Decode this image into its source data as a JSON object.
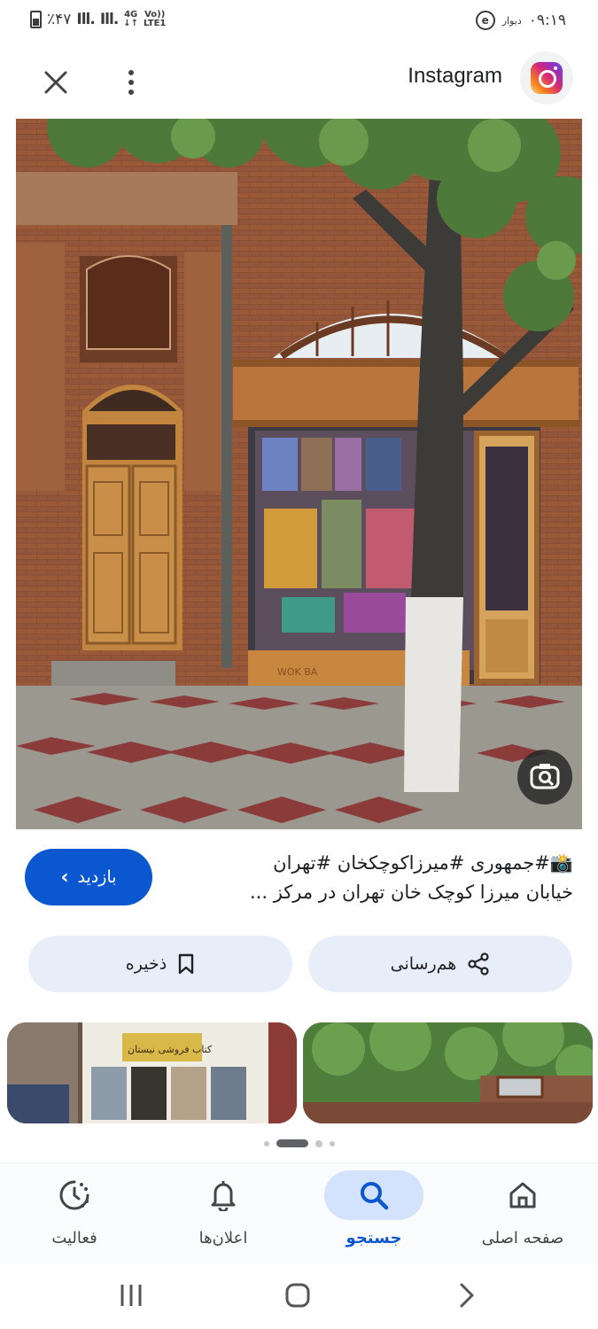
{
  "status_bar": {
    "battery": "٪۴۷",
    "network_type": "4G",
    "volte": "Vo))",
    "lte": "LTE1",
    "time": "۰۹:۱۹",
    "notification_app_label": "دیوار",
    "notification_app_glyph": "e"
  },
  "header": {
    "source_name": "Instagram",
    "close_icon": "close-icon",
    "more_icon": "more-vertical-icon",
    "source_logo": "instagram-logo"
  },
  "image": {
    "storefront_sign": "WOK BA",
    "lens_icon": "lens-search-icon"
  },
  "result": {
    "caption_line1": "📸#جمهوری #میرزاکوچکخان #تهران",
    "caption_line2": "خیابان میرزا کوچک خان تهران در مرکز ...",
    "visit_label": "بازدید",
    "visit_icon": "chevron-left-icon"
  },
  "actions": {
    "save_label": "ذخیره",
    "save_icon": "bookmark-icon",
    "share_label": "هم‌رسانی",
    "share_icon": "share-icon"
  },
  "related_images": {
    "thumb1_sign": "کتاب فروشی نیستان",
    "thumb2_alt": "tree-building"
  },
  "pager": {
    "count": 4,
    "active_index": 1
  },
  "bottom_nav": {
    "activity_label": "فعالیت",
    "notifications_label": "اعلان‌ها",
    "search_label": "جستجو",
    "home_label": "صفحه اصلی",
    "active": "search"
  },
  "colors": {
    "accent": "#0b57d0",
    "accent_light": "#d3e3fd",
    "chip_bg": "#e8eef9"
  }
}
